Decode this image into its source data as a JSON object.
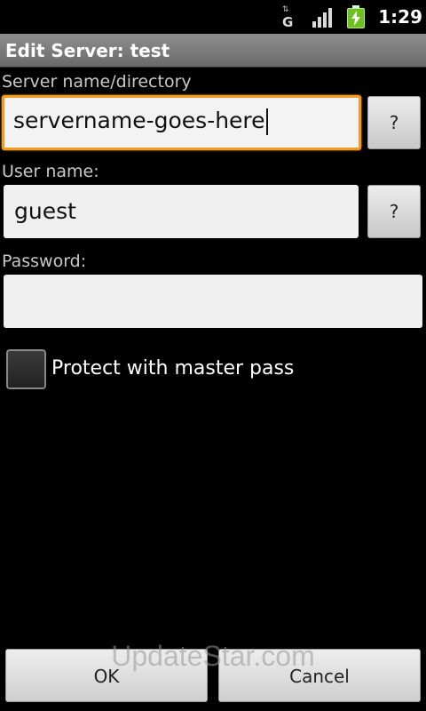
{
  "status_bar": {
    "network_type": "G",
    "time": "1:29",
    "icons": {
      "network": "data-arrows-icon",
      "signal": "signal-bars-icon",
      "battery": "battery-charging-icon"
    }
  },
  "title_bar": {
    "title": "Edit Server: test"
  },
  "form": {
    "server": {
      "label": "Server name/directory",
      "value": "servername-goes-here",
      "help_label": "?"
    },
    "user": {
      "label": "User name:",
      "value": "guest",
      "help_label": "?"
    },
    "password": {
      "label": "Password:",
      "value": ""
    },
    "protect": {
      "label": "Protect with master pass",
      "checked": false
    }
  },
  "buttons": {
    "ok": "OK",
    "cancel": "Cancel"
  },
  "watermark": "UpdateStar.com",
  "colors": {
    "focus": "#f59a1c",
    "battery": "#6cc020",
    "background": "#000000"
  }
}
